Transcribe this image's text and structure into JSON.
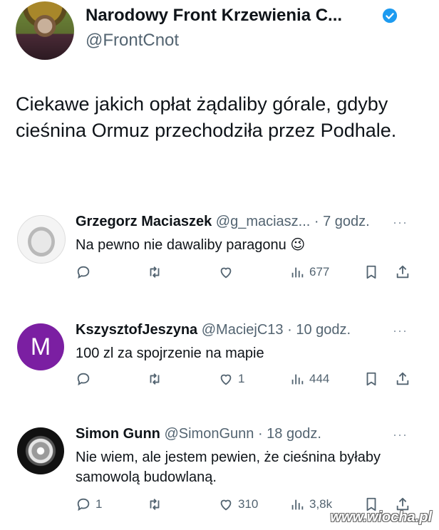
{
  "post": {
    "author_name": "Narodowy Front Krzewienia C...",
    "author_handle": "@FrontCnot",
    "text": "Ciekawe jakich opłat żądaliby górale, gdyby cieśnina Ormuz przechodziła przez Podhale."
  },
  "replies": [
    {
      "name": "Grzegorz Maciaszek",
      "handle": "@g_maciasz...",
      "time": "· 7 godz.",
      "text": "Na pewno nie dawaliby paragonu 😉",
      "replies_count": "",
      "retweets": "",
      "likes": "",
      "views": "677"
    },
    {
      "name": "KszysztofJeszyna",
      "handle": "@MaciejC13",
      "time": "· 10 godz.",
      "avatar_letter": "M",
      "text": "100 zl za spojrzenie na mapie",
      "replies_count": "",
      "retweets": "",
      "likes": "1",
      "views": "444"
    },
    {
      "name": "Simon Gunn",
      "handle": "@SimonGunn",
      "time": "· 18 godz.",
      "text": "Nie wiem, ale jestem pewien, że cieśnina byłaby samowolą budowlaną.",
      "replies_count": "1",
      "retweets": "",
      "likes": "310",
      "views": "3,8k"
    }
  ],
  "more_label": "···",
  "watermark": "www.wiocha.pl",
  "colors": {
    "verified": "#1d9bf0",
    "secondary_text": "#536471",
    "avatar_purple": "#7b1fa2"
  },
  "icons": [
    "verified-badge-icon",
    "reply-icon",
    "retweet-icon",
    "like-icon",
    "views-icon",
    "bookmark-icon",
    "share-icon",
    "more-icon"
  ]
}
